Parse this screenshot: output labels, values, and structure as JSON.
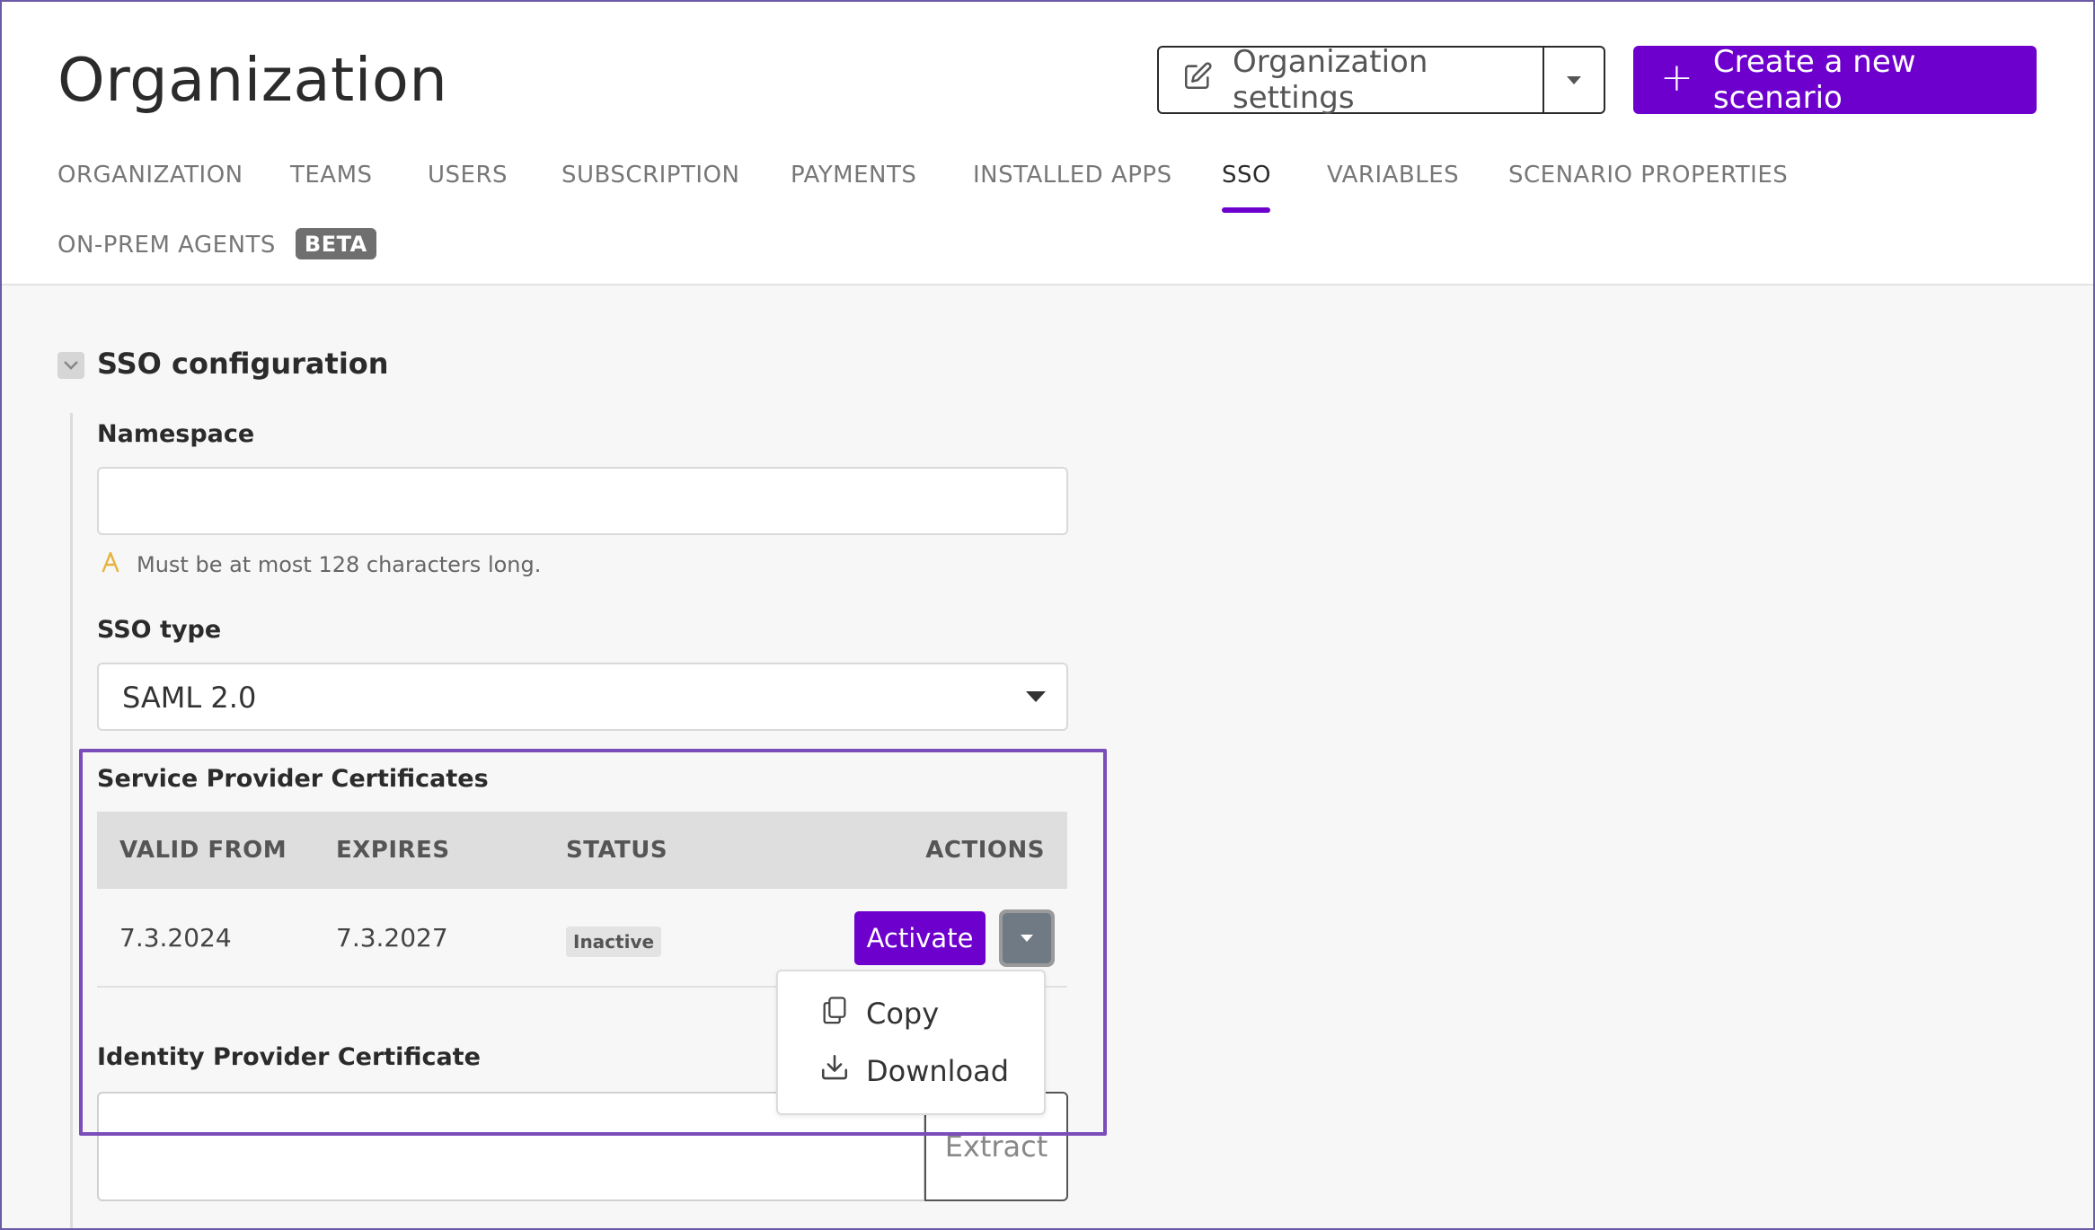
{
  "header": {
    "title": "Organization",
    "org_settings_label": "Organization settings",
    "create_label": "Create a new scenario"
  },
  "tabs": [
    {
      "label": "ORGANIZATION"
    },
    {
      "label": "TEAMS"
    },
    {
      "label": "USERS"
    },
    {
      "label": "SUBSCRIPTION"
    },
    {
      "label": "PAYMENTS"
    },
    {
      "label": "INSTALLED APPS"
    },
    {
      "label": "SSO",
      "active": true
    },
    {
      "label": "VARIABLES"
    },
    {
      "label": "SCENARIO PROPERTIES"
    },
    {
      "label": "ON-PREM AGENTS",
      "badge": "BETA"
    }
  ],
  "sso": {
    "section_title": "SSO configuration",
    "namespace_label": "Namespace",
    "namespace_value": "",
    "namespace_hint": "Must be at most 128 characters long.",
    "type_label": "SSO type",
    "type_value": "SAML 2.0",
    "sp_title": "Service Provider Certificates",
    "columns": [
      "VALID FROM",
      "EXPIRES",
      "STATUS",
      "ACTIONS"
    ],
    "rows": [
      {
        "valid_from": "7.3.2024",
        "expires": "7.3.2027",
        "status": "Inactive",
        "action": "Activate"
      }
    ],
    "menu": [
      {
        "label": "Copy",
        "icon": "copy-icon"
      },
      {
        "label": "Download",
        "icon": "download-icon"
      }
    ],
    "idp_title": "Identity Provider Certificate",
    "idp_value": "",
    "extract_label": "Extract"
  },
  "colors": {
    "accent": "#6d00cc",
    "highlight": "#7a4dbb",
    "warning": "#e8b33a"
  }
}
